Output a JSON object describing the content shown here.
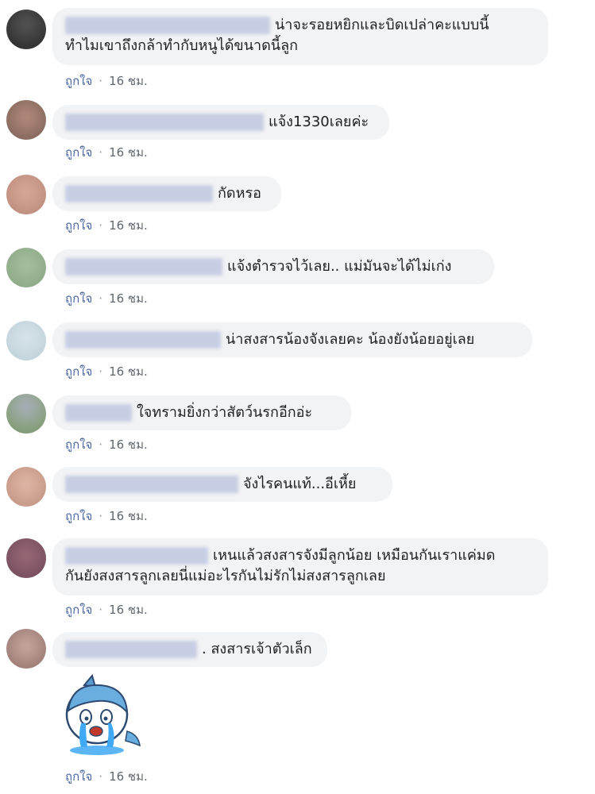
{
  "comments": [
    {
      "text_line1": "น่าจะรอยหยิกและบิดเปล่าคะแบบนี้",
      "text_line2": "ทำไมเขาถึงกล้าทำกับหนูได้ขนาดนี้ลูก",
      "like_label": "ถูกใจ",
      "time": "16 ชม."
    },
    {
      "text": "แจ้ง1330เลยค่ะ",
      "like_label": "ถูกใจ",
      "time": "16 ชม."
    },
    {
      "text": "กัดหรอ",
      "like_label": "ถูกใจ",
      "time": "16 ชม."
    },
    {
      "text": "แจ้งตำรวจไว้เลย.. แม่มันจะได้ไม่เก่ง",
      "like_label": "ถูกใจ",
      "time": "16 ชม."
    },
    {
      "text": "น่าสงสารน้องจังเลยคะ น้องยังน้อยอยู่เลย",
      "like_label": "ถูกใจ",
      "time": "16 ชม."
    },
    {
      "text": "ใจทรามยิ่งกว่าสัตว์นรกอีกอ่ะ",
      "like_label": "ถูกใจ",
      "time": "16 ชม."
    },
    {
      "text": "จังไรคนแท้...อีเหี้ย",
      "like_label": "ถูกใจ",
      "time": "16 ชม."
    },
    {
      "text_line1": "เหนแล้วสงสารจังมีลูกน้อย เหมือนกันเราแค่มด",
      "text_line2": "กันยังสงสารลูกเลยนี่แม่อะไรกันไม่รักไม่สงสารลูกเลย",
      "like_label": "ถูกใจ",
      "time": "16 ชม."
    },
    {
      "text": ". สงสารเจ้าตัวเล็ก",
      "like_label": "ถูกใจ",
      "time": "16 ชม."
    }
  ],
  "colors": {
    "bubble": "#f2f3f5",
    "like": "#4b67a1",
    "meta": "#616770"
  },
  "icons": {
    "sticker": "crying-bird-sticker"
  }
}
